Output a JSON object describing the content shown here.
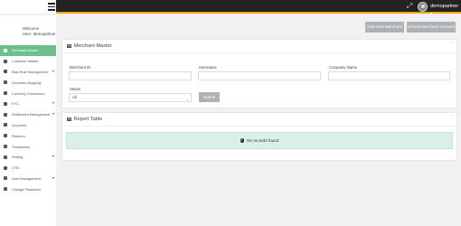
{
  "topbar": {
    "user_name": "demopartner",
    "icons": [
      "menu-icon",
      "expand-icon",
      "user-avatar"
    ]
  },
  "sidebar": {
    "welcome": "Welcome",
    "user_line": "User: demopartner",
    "items": [
      {
        "label": "Merchant Master",
        "icon": "user-icon",
        "active": true,
        "caret": false
      },
      {
        "label": "Customer Master",
        "icon": "user-icon",
        "active": false,
        "caret": false
      },
      {
        "label": "Bias Rule Management",
        "icon": "rules-icon",
        "active": false,
        "caret": true
      },
      {
        "label": "Vouchers Mapping",
        "icon": "tag-icon",
        "active": false,
        "caret": false
      },
      {
        "label": "Currency Conversion",
        "icon": "refresh-icon",
        "active": false,
        "caret": false
      },
      {
        "label": "KYC",
        "icon": "id-icon",
        "active": false,
        "caret": true
      },
      {
        "label": "Settlement Management",
        "icon": "settle-icon",
        "active": false,
        "caret": true
      },
      {
        "label": "Vouchers",
        "icon": "tag-icon",
        "active": false,
        "caret": false
      },
      {
        "label": "Redeem",
        "icon": "redeem-icon",
        "active": false,
        "caret": false
      },
      {
        "label": "Transaction",
        "icon": "transaction-icon",
        "active": false,
        "caret": false
      },
      {
        "label": "Setting",
        "icon": "gear-icon",
        "active": false,
        "caret": true
      },
      {
        "label": "OTB",
        "icon": "otb-icon",
        "active": false,
        "caret": false
      },
      {
        "label": "User Management",
        "icon": "users-icon",
        "active": false,
        "caret": true
      },
      {
        "label": "Change Password",
        "icon": "lock-icon",
        "active": false,
        "caret": false
      }
    ]
  },
  "actions": {
    "add_merchant": "Add New Merchant",
    "unlock_merchant": "Unlock Merchant Account"
  },
  "merchant_panel": {
    "title": "Merchant Master",
    "merchant_id_label": "Merchant ID",
    "merchant_id_value": "",
    "username_label": "Username",
    "username_value": "",
    "company_label": "Company Name",
    "company_value": "",
    "status_label": "Status",
    "status_selected": "All",
    "search_button": "Search"
  },
  "report_panel": {
    "title": "Report Table",
    "empty_message": "No records found"
  },
  "colors": {
    "accent": "#f39c12",
    "active_nav": "#6dbf8b",
    "topbar": "#232323",
    "button": "#aeb2b4",
    "notice": "#d9f0e8"
  }
}
